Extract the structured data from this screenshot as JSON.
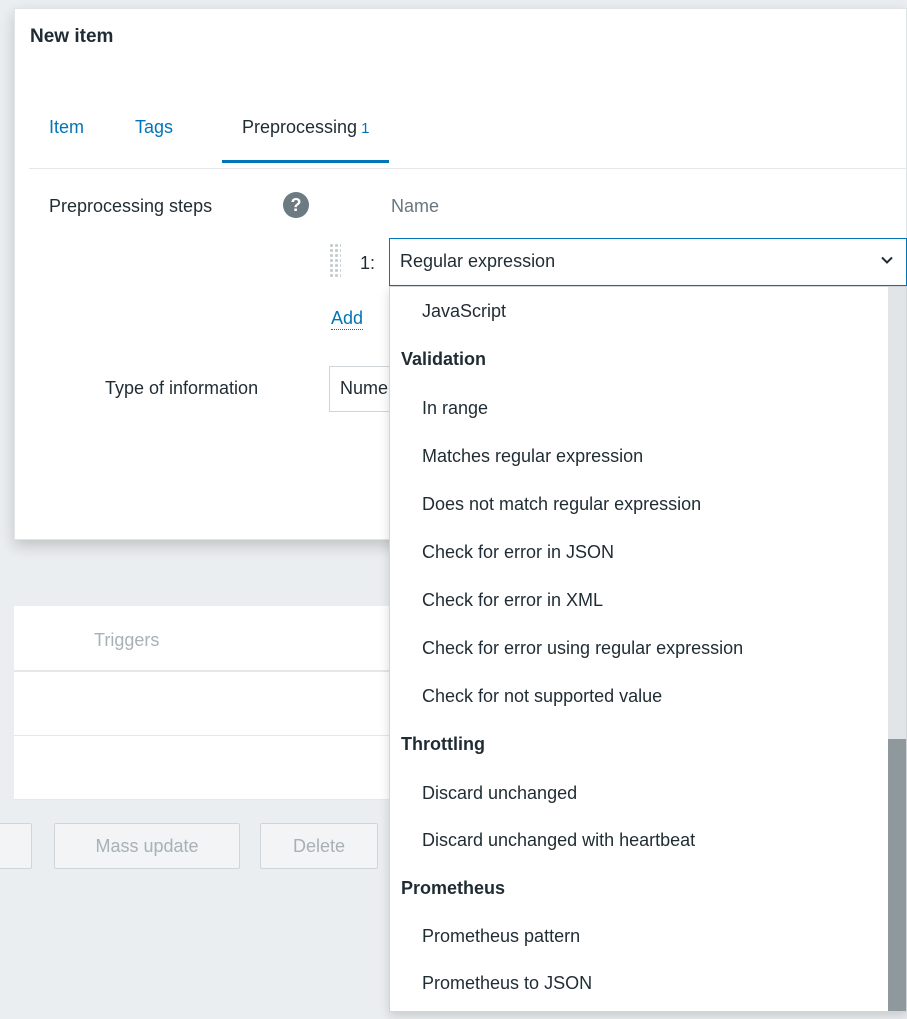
{
  "modal": {
    "title": "New item",
    "tabs": [
      {
        "label": "Item"
      },
      {
        "label": "Tags"
      },
      {
        "label": "Preprocessing",
        "count": "1"
      }
    ],
    "preprocessing_label": "Preprocessing steps",
    "help_icon": "?",
    "name_column": "Name",
    "step_number": "1:",
    "selected_step": "Regular expression",
    "add_link": "Add",
    "type_label": "Type of information",
    "type_value": "Numeric (unsigned)"
  },
  "dropdown": {
    "items": [
      {
        "kind": "option",
        "label": "JavaScript"
      },
      {
        "kind": "group",
        "label": "Validation"
      },
      {
        "kind": "option",
        "label": "In range"
      },
      {
        "kind": "option",
        "label": "Matches regular expression"
      },
      {
        "kind": "option",
        "label": "Does not match regular expression"
      },
      {
        "kind": "option",
        "label": "Check for error in JSON"
      },
      {
        "kind": "option",
        "label": "Check for error in XML"
      },
      {
        "kind": "option",
        "label": "Check for error using regular expression"
      },
      {
        "kind": "option",
        "label": "Check for not supported value"
      },
      {
        "kind": "group",
        "label": "Throttling"
      },
      {
        "kind": "option",
        "label": "Discard unchanged"
      },
      {
        "kind": "option",
        "label": "Discard unchanged with heartbeat"
      },
      {
        "kind": "group",
        "label": "Prometheus"
      },
      {
        "kind": "option",
        "label": "Prometheus pattern"
      },
      {
        "kind": "option",
        "label": "Prometheus to JSON"
      }
    ]
  },
  "background": {
    "table_header": "Triggers",
    "buttons": [
      "Mass update",
      "Delete"
    ]
  },
  "colors": {
    "accent": "#0275b8",
    "text": "#1f2c33",
    "muted": "#a8b1b6"
  },
  "icons": {
    "help": "help-icon",
    "chevron": "chevron-down-icon",
    "drag": "drag-handle-icon"
  }
}
